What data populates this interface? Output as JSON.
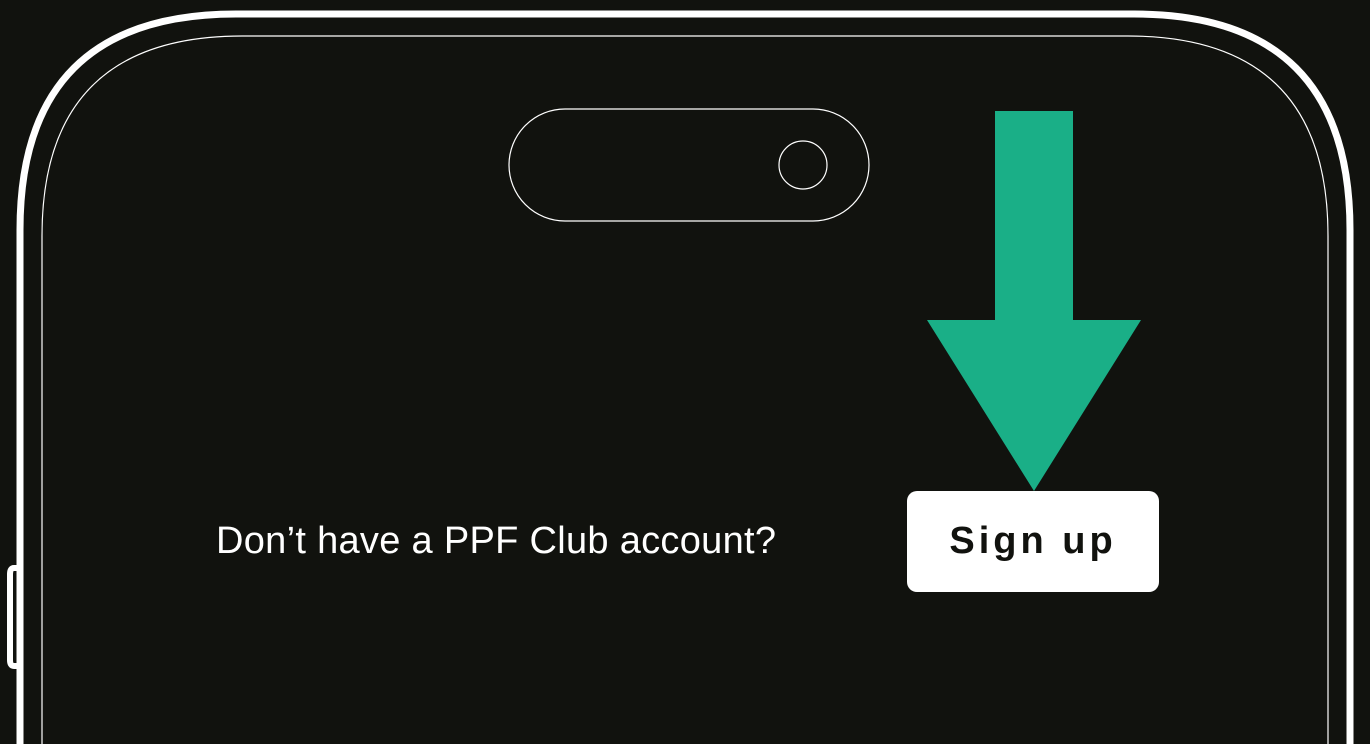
{
  "signup_prompt": {
    "text": "Don’t have a PPF Club account?",
    "button_label": "Sign up"
  },
  "colors": {
    "background": "#11120e",
    "arrow": "#1aaf87",
    "outline": "#ffffff",
    "button_bg": "#ffffff",
    "button_text": "#11120e"
  },
  "icons": {
    "camera": "camera-lens-icon",
    "pointer": "arrow-down-icon"
  }
}
